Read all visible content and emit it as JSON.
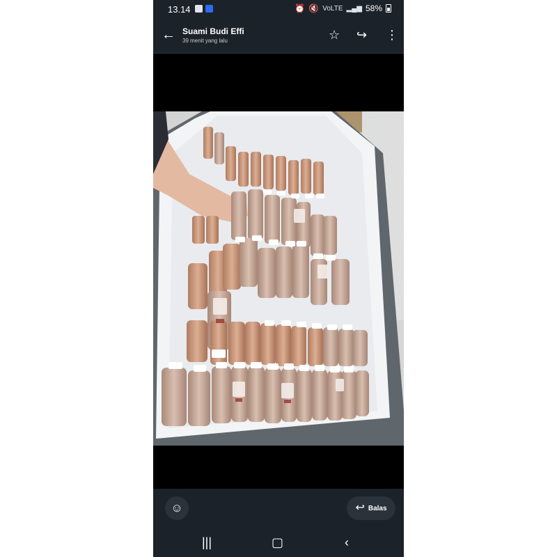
{
  "status": {
    "time": "13.14",
    "network": "VoLTE",
    "battery": "58%"
  },
  "header": {
    "title": "Suami Budi Effi",
    "subtitle": "39 menit yang lalu"
  },
  "icons": {
    "back": "arrow-left-icon",
    "star": "star-icon",
    "forward": "forward-icon",
    "more": "more-vert-icon",
    "emoji": "emoji-add-icon",
    "reply": "reply-icon"
  },
  "reply": {
    "label": "Balas"
  },
  "colors": {
    "bar_bg": "#1c222a",
    "media_bg": "#000000"
  }
}
